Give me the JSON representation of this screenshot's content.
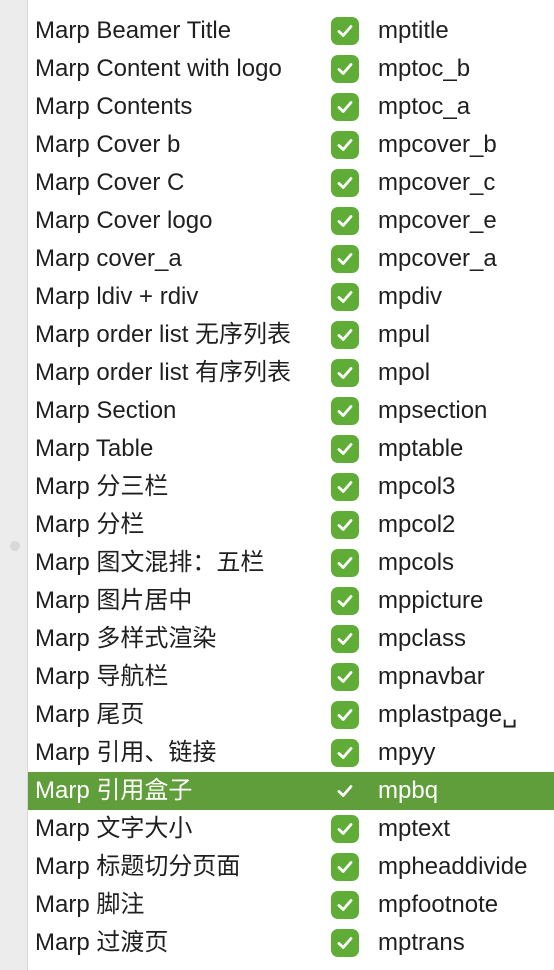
{
  "snippets": {
    "rows": [
      {
        "name": "Marp Beamer Title",
        "abbreviation": "mptitle",
        "enabled": true
      },
      {
        "name": "Marp Content with logo",
        "abbreviation": "mptoc_b",
        "enabled": true
      },
      {
        "name": "Marp Contents",
        "abbreviation": "mptoc_a",
        "enabled": true
      },
      {
        "name": "Marp Cover b",
        "abbreviation": "mpcover_b",
        "enabled": true
      },
      {
        "name": "Marp Cover C",
        "abbreviation": "mpcover_c",
        "enabled": true
      },
      {
        "name": "Marp Cover logo",
        "abbreviation": "mpcover_e",
        "enabled": true
      },
      {
        "name": "Marp cover_a",
        "abbreviation": "mpcover_a",
        "enabled": true
      },
      {
        "name": "Marp ldiv + rdiv",
        "abbreviation": "mpdiv",
        "enabled": true
      },
      {
        "name": "Marp order list 无序列表",
        "abbreviation": "mpul",
        "enabled": true
      },
      {
        "name": "Marp order list 有序列表",
        "abbreviation": "mpol",
        "enabled": true
      },
      {
        "name": "Marp Section",
        "abbreviation": "mpsection",
        "enabled": true
      },
      {
        "name": "Marp Table",
        "abbreviation": "mptable",
        "enabled": true
      },
      {
        "name": "Marp 分三栏",
        "abbreviation": "mpcol3",
        "enabled": true
      },
      {
        "name": "Marp 分栏",
        "abbreviation": "mpcol2",
        "enabled": true
      },
      {
        "name": "Marp 图文混排：五栏",
        "abbreviation": "mpcols",
        "enabled": true
      },
      {
        "name": "Marp 图片居中",
        "abbreviation": "mppicture",
        "enabled": true
      },
      {
        "name": "Marp 多样式渲染",
        "abbreviation": "mpclass",
        "enabled": true
      },
      {
        "name": "Marp 导航栏",
        "abbreviation": "mpnavbar",
        "enabled": true
      },
      {
        "name": "Marp 尾页",
        "abbreviation": "mplastpage␣",
        "enabled": true
      },
      {
        "name": "Marp 引用、链接",
        "abbreviation": "mpyy",
        "enabled": true
      },
      {
        "name": "Marp 引用盒子",
        "abbreviation": "mpbq",
        "enabled": true,
        "selected": true
      },
      {
        "name": "Marp 文字大小",
        "abbreviation": "mptext",
        "enabled": true
      },
      {
        "name": "Marp 标题切分页面",
        "abbreviation": "mpheaddivide",
        "enabled": true
      },
      {
        "name": "Marp 脚注",
        "abbreviation": "mpfootnote",
        "enabled": true
      },
      {
        "name": "Marp 过渡页",
        "abbreviation": "mptrans",
        "enabled": true
      }
    ]
  },
  "colors": {
    "checkbox": "#5fad36",
    "selected_row": "#5f9e3a",
    "text": "#1f1f1f"
  },
  "icons": {
    "checkbox": "checkmark-icon",
    "splitter": "splitter-handle-icon"
  }
}
